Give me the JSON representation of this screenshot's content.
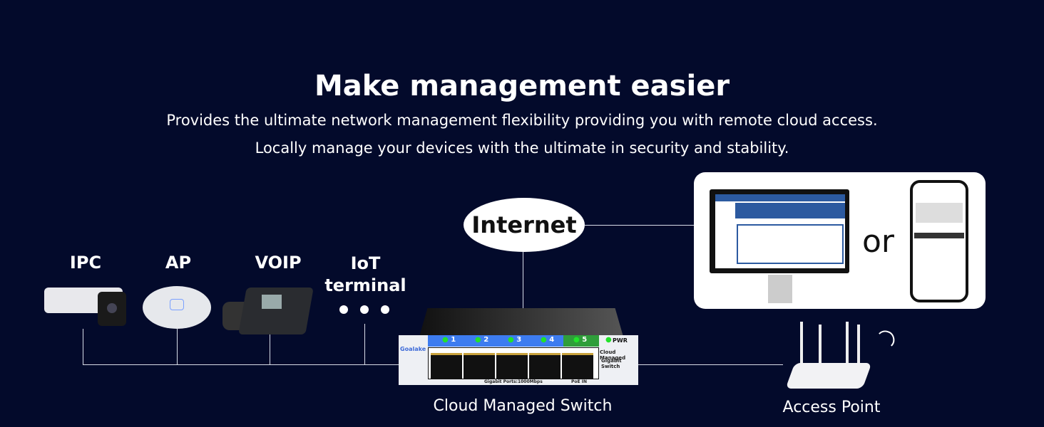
{
  "heading": "Make management easier",
  "subtitle_lines": [
    "Provides the ultimate network management flexibility providing you with remote cloud access.",
    "Locally manage your devices with the ultimate in security and stability."
  ],
  "devices": [
    {
      "label": "IPC",
      "icon": "camera-icon"
    },
    {
      "label": "AP",
      "icon": "ceiling-access-point-icon"
    },
    {
      "label": "VOIP",
      "icon": "ip-phone-icon"
    },
    {
      "label": "IoT terminal",
      "icon": "ellipsis-icon"
    }
  ],
  "internet_label": "Internet",
  "management": {
    "separator": "or",
    "options": [
      "monitor-web-ui-icon",
      "smartphone-app-icon"
    ]
  },
  "switch": {
    "label": "Cloud Managed Switch",
    "brand": "Goalake",
    "ports": [
      "1",
      "2",
      "3",
      "4",
      "5"
    ],
    "pwr": "PWR",
    "model_text": [
      "Cloud Managed",
      "Gigabit Switch"
    ],
    "ports_text": "Gigabit Ports:1000Mbps",
    "poe_text": "PoE IN",
    "colors": {
      "port_bar": "#3d7cf0",
      "poe_bar": "#2f9e3a",
      "led": "#22e22a"
    }
  },
  "access_point": {
    "label": "Access Point",
    "icon": "wifi-router-icon"
  }
}
